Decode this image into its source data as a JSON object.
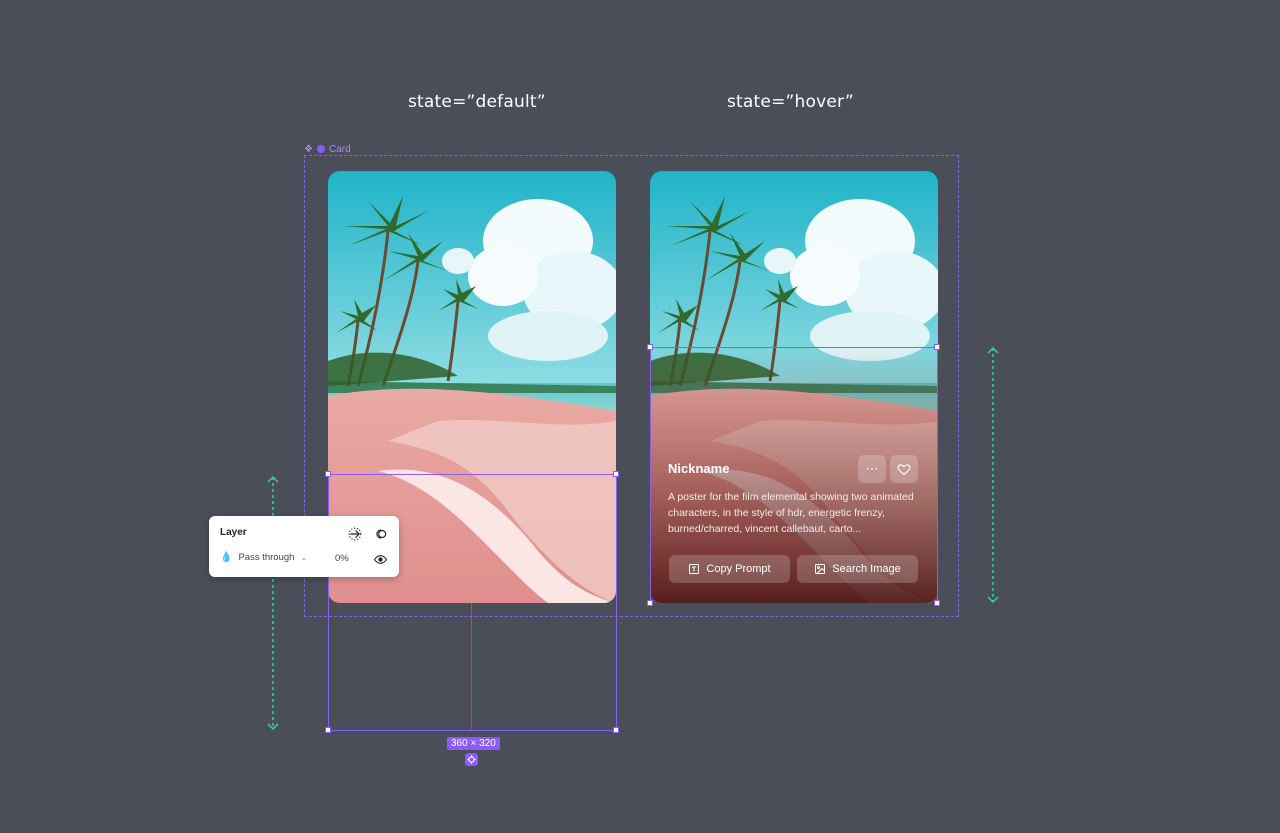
{
  "canvas": {
    "state_default_label": "state=”default”",
    "state_hover_label": "state=”hover”",
    "component_name": "Card",
    "size_badge": "360 × 320"
  },
  "hover_card": {
    "nickname": "Nickname",
    "description": "A poster for the film elemental showing two animated characters, in the style of hdr, energetic frenzy, burned/charred, vincent callebaut, carto...",
    "copy_prompt_label": "Copy Prompt",
    "search_image_label": "Search Image"
  },
  "layer_panel": {
    "title": "Layer",
    "blend_mode": "Pass through",
    "opacity": "0%"
  },
  "colors": {
    "canvas_bg": "#4a4e58",
    "selection": "#8b5cf6",
    "spacing_guide": "#34d399"
  },
  "icons": [
    "component-icon",
    "go-to-icon",
    "mask-icon",
    "drop-icon",
    "chevron-down-icon",
    "eye-icon",
    "more-icon",
    "heart-icon",
    "text-icon",
    "image-icon",
    "target-icon"
  ]
}
